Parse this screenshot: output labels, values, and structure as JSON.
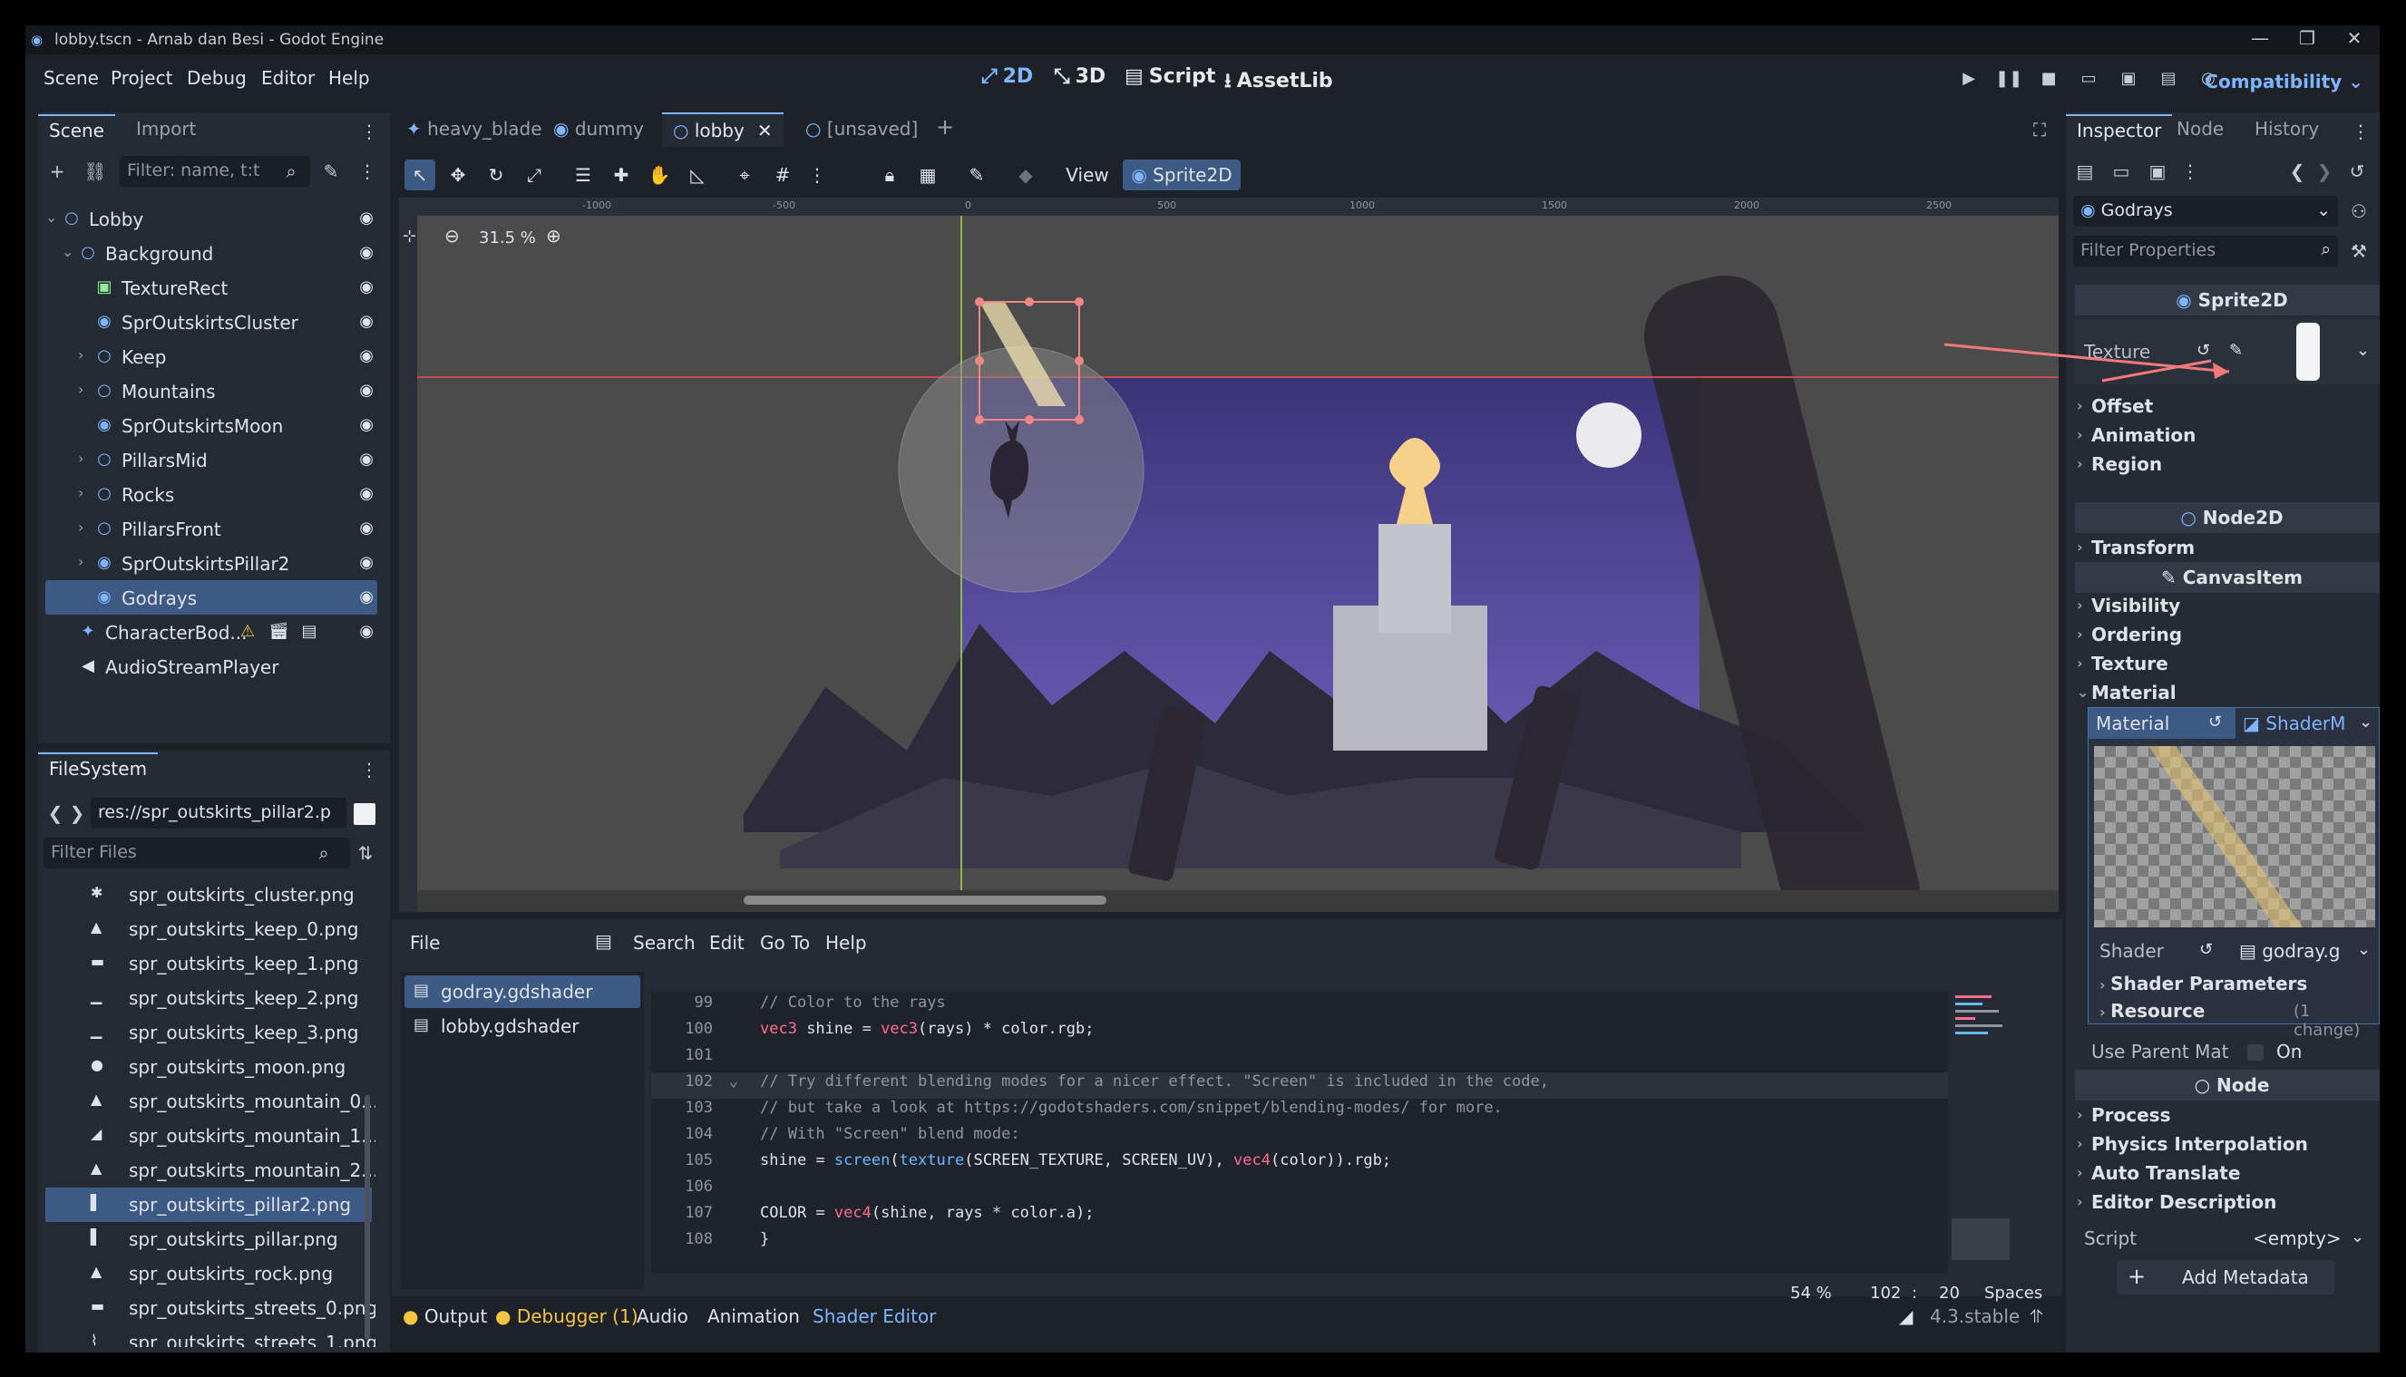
{
  "window": {
    "title": "lobby.tscn - Arnab dan Besi - Godot Engine",
    "minimize": "—",
    "maximize": "❐",
    "close": "✕"
  },
  "menu": [
    "Scene",
    "Project",
    "Debug",
    "Editor",
    "Help"
  ],
  "workspaces": [
    {
      "label": "2D",
      "icon": "⤢"
    },
    {
      "label": "3D",
      "icon": "⤡"
    },
    {
      "label": "Script",
      "icon": "▤"
    },
    {
      "label": "AssetLib",
      "icon": "⭳"
    }
  ],
  "renderer": "Compatibility",
  "scene_dock": {
    "tabs": [
      "Scene",
      "Import"
    ],
    "filter_placeholder": "Filter: name, t:t",
    "nodes": [
      {
        "name": "Lobby",
        "icon": "○",
        "color": "#7fb5ff"
      },
      {
        "name": "Background",
        "icon": "○",
        "color": "#7fb5ff"
      },
      {
        "name": "TextureRect",
        "icon": "▣",
        "color": "#8eef97"
      },
      {
        "name": "SprOutskirtsCluster",
        "icon": "◉",
        "color": "#7fb5ff"
      },
      {
        "name": "Keep",
        "icon": "○",
        "color": "#7fb5ff"
      },
      {
        "name": "Mountains",
        "icon": "○",
        "color": "#7fb5ff"
      },
      {
        "name": "SprOutskirtsMoon",
        "icon": "◉",
        "color": "#7fb5ff"
      },
      {
        "name": "PillarsMid",
        "icon": "○",
        "color": "#7fb5ff"
      },
      {
        "name": "Rocks",
        "icon": "○",
        "color": "#7fb5ff"
      },
      {
        "name": "PillarsFront",
        "icon": "○",
        "color": "#7fb5ff"
      },
      {
        "name": "SprOutskirtsPillar2",
        "icon": "◉",
        "color": "#7fb5ff"
      },
      {
        "name": "Godrays",
        "icon": "◉",
        "color": "#7fb5ff"
      },
      {
        "name": "CharacterBod...",
        "icon": "✦",
        "color": "#7fb5ff"
      },
      {
        "name": "AudioStreamPlayer",
        "icon": "◀",
        "color": "#dfe2e8"
      }
    ]
  },
  "filesystem": {
    "tab": "FileSystem",
    "path": "res://spr_outskirts_pillar2.p",
    "filter_placeholder": "Filter Files",
    "files": [
      {
        "name": "spr_outskirts_cluster.png",
        "icon": "✱"
      },
      {
        "name": "spr_outskirts_keep_0.png",
        "icon": "▲"
      },
      {
        "name": "spr_outskirts_keep_1.png",
        "icon": "▬"
      },
      {
        "name": "spr_outskirts_keep_2.png",
        "icon": "▁"
      },
      {
        "name": "spr_outskirts_keep_3.png",
        "icon": "▁"
      },
      {
        "name": "spr_outskirts_moon.png",
        "icon": "●"
      },
      {
        "name": "spr_outskirts_mountain_0....",
        "icon": "▲"
      },
      {
        "name": "spr_outskirts_mountain_1....",
        "icon": "◢"
      },
      {
        "name": "spr_outskirts_mountain_2....",
        "icon": "▲"
      },
      {
        "name": "spr_outskirts_pillar2.png",
        "icon": "▌"
      },
      {
        "name": "spr_outskirts_pillar.png",
        "icon": "▌"
      },
      {
        "name": "spr_outskirts_rock.png",
        "icon": "▲"
      },
      {
        "name": "spr_outskirts_streets_0.png",
        "icon": "▬"
      },
      {
        "name": "spr_outskirts_streets_1.png",
        "icon": "⌇"
      }
    ]
  },
  "editor_tabs": [
    "heavy_blade",
    "dummy",
    "lobby",
    "[unsaved]"
  ],
  "toolbar": {
    "view": "View",
    "sprite_menu": "Sprite2D"
  },
  "viewport": {
    "zoom": "31.5 %",
    "ruler_labels": [
      "-1000",
      "-500",
      "0",
      "500",
      "1000",
      "1500",
      "2000",
      "2500"
    ]
  },
  "script_editor": {
    "menu": [
      "File",
      "Search",
      "Edit",
      "Go To",
      "Help"
    ],
    "scripts": [
      "godray.gdshader",
      "lobby.gdshader"
    ],
    "lines": [
      {
        "n": "99",
        "text": "// Color to the rays",
        "kind": "comment"
      },
      {
        "n": "100",
        "text": "vec3 shine = vec3(rays) * color.rgb;",
        "kind": "code"
      },
      {
        "n": "101",
        "text": "",
        "kind": "code"
      },
      {
        "n": "102",
        "text": "// Try different blending modes for a nicer effect. \"Screen\" is included in the code,",
        "kind": "comment"
      },
      {
        "n": "103",
        "text": "// but take a look at https://godotshaders.com/snippet/blending-modes/ for more.",
        "kind": "comment"
      },
      {
        "n": "104",
        "text": "// With \"Screen\" blend mode:",
        "kind": "comment"
      },
      {
        "n": "105",
        "text": "shine = screen(texture(SCREEN_TEXTURE, SCREEN_UV), vec4(color)).rgb;",
        "kind": "code"
      },
      {
        "n": "106",
        "text": "",
        "kind": "code"
      },
      {
        "n": "107",
        "text": "COLOR = vec4(shine, rays * color.a);",
        "kind": "code"
      },
      {
        "n": "108",
        "text": "}",
        "kind": "code"
      }
    ],
    "status": {
      "zoom": "54 %",
      "line": "102",
      "sep": ":",
      "col": "20",
      "indent": "Spaces"
    }
  },
  "bottom_panel": {
    "tabs": [
      "Output",
      "Debugger (1)",
      "Audio",
      "Animation",
      "Shader Editor"
    ],
    "version": "4.3.stable"
  },
  "inspector": {
    "tabs": [
      "Inspector",
      "Node",
      "History"
    ],
    "object": "Godrays",
    "filter_placeholder": "Filter Properties",
    "sprite_header": "Sprite2D",
    "texture_label": "Texture",
    "sections_sprite": [
      "Offset",
      "Animation",
      "Region"
    ],
    "node2d_header": "Node2D",
    "sections_node2d": [
      "Transform"
    ],
    "canvas_header": "CanvasItem",
    "sections_canvas": [
      "Visibility",
      "Ordering",
      "Texture",
      "Material"
    ],
    "material_label": "Material",
    "material_value": "ShaderM",
    "shader_label": "Shader",
    "shader_value": "godray.g",
    "shader_params": "Shader Parameters",
    "resource": "Resource",
    "resource_note": "(1 change)",
    "use_parent": "Use Parent Mat",
    "use_parent_value": "On",
    "node_header": "Node",
    "sections_node": [
      "Process",
      "Physics Interpolation",
      "Auto Translate",
      "Editor Description"
    ],
    "script_label": "Script",
    "script_value": "<empty>",
    "add_metadata": "Add Metadata"
  }
}
